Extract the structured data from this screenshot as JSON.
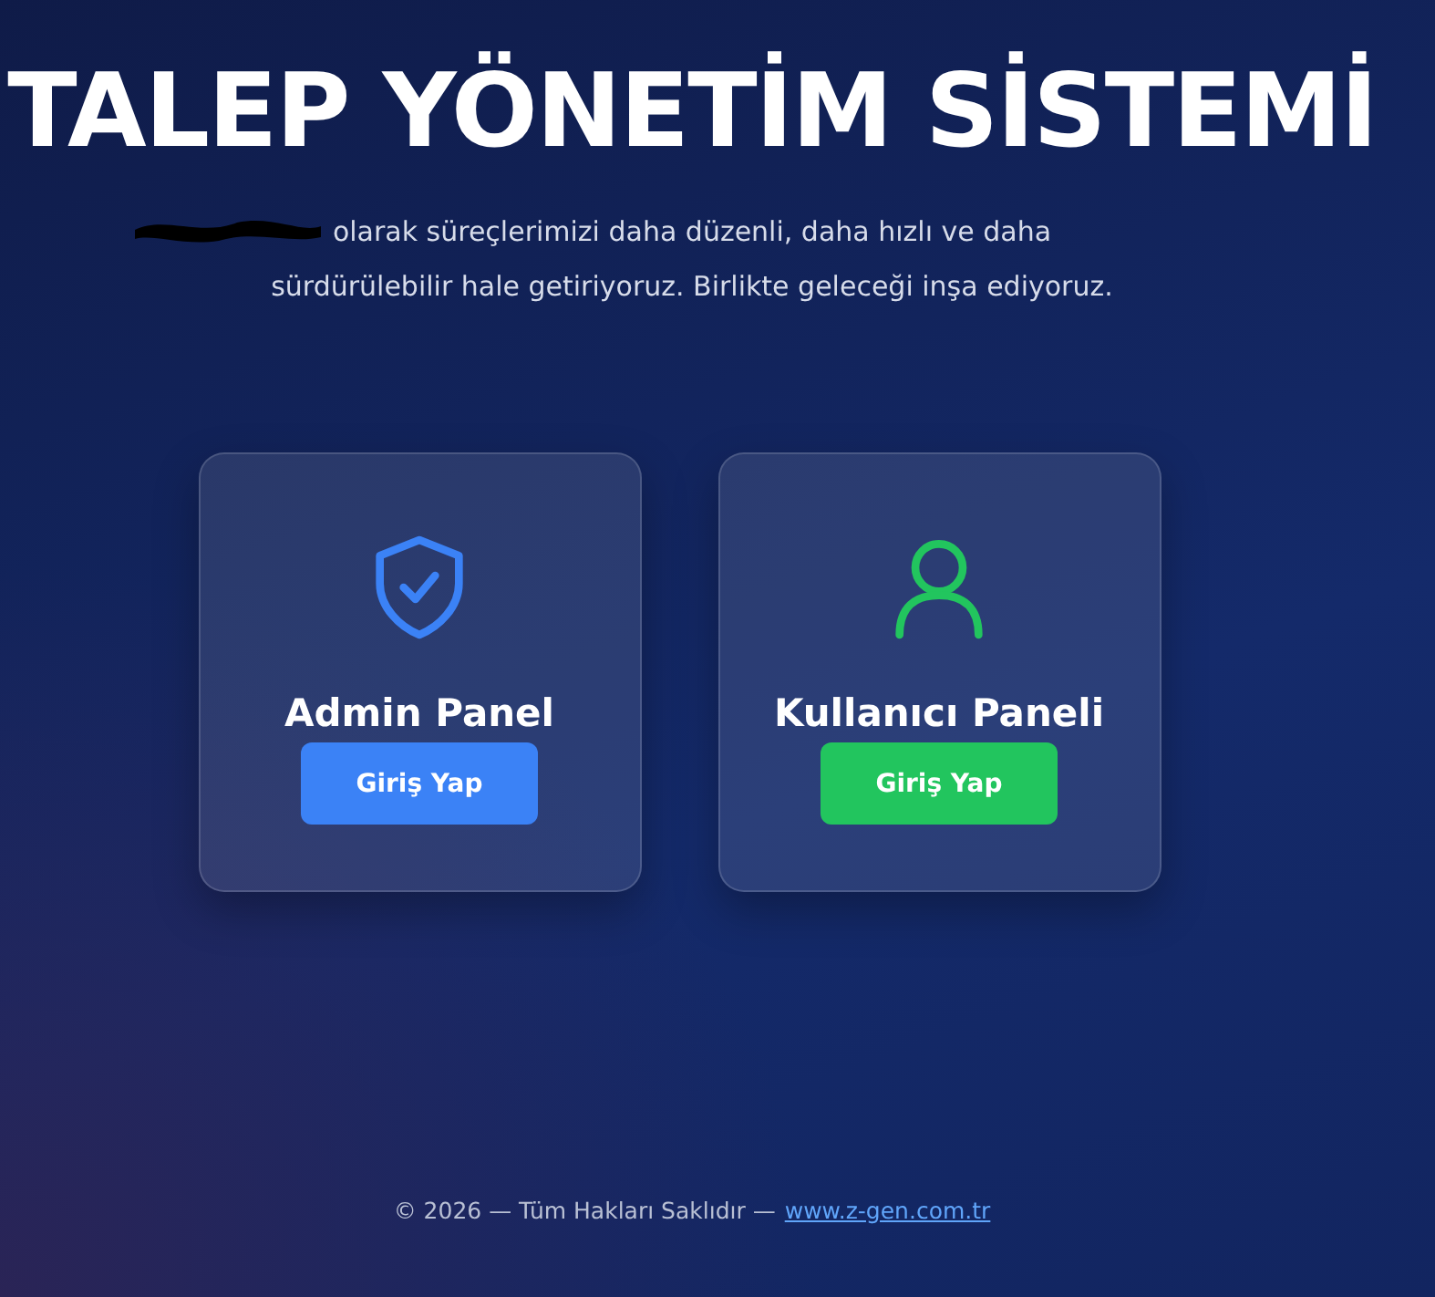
{
  "title": "TALEP YÖNETİM SİSTEMİ",
  "subtitle": {
    "lines": [
      "olarak süreçlerimizi daha düzenli, daha hızlı ve daha",
      "sürdürülebilir hale getiriyoruz. Birlikte geleceği inşa ediyoruz."
    ],
    "redacted": true
  },
  "cards": [
    {
      "kind": "admin",
      "title": "Admin Panel",
      "button": "Giriş Yap",
      "color": "#3b82f6"
    },
    {
      "kind": "user",
      "title": "Kullanıcı Paneli",
      "button": "Giriş Yap",
      "color": "#22c55e"
    }
  ],
  "footer": {
    "text": "© 2026 — Tüm Hakları Saklıdır —",
    "link": "www.z-gen.com.tr"
  }
}
